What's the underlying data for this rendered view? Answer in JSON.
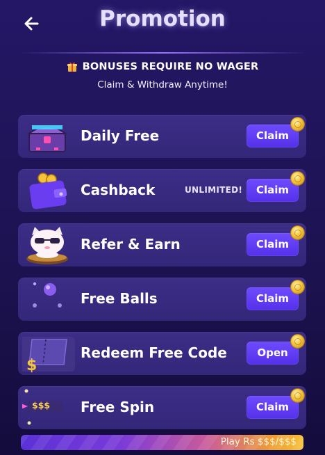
{
  "header": {
    "title": "Promotion",
    "back_icon": "arrow-left-icon"
  },
  "notice": {
    "line1": "BONUSES REQUIRE NO WAGER",
    "line2": "Claim & Withdraw Anytime!",
    "icon": "gift-icon"
  },
  "promotions": [
    {
      "name": "Daily Free",
      "button": "Claim",
      "icon": "treasure-chest-icon"
    },
    {
      "name": "Cashback",
      "badge": "UNLIMITED!",
      "button": "Claim",
      "icon": "wallet-coins-icon"
    },
    {
      "name": "Refer & Earn",
      "button": "Claim",
      "icon": "lucky-cat-icon"
    },
    {
      "name": "Free Balls",
      "button": "Claim",
      "icon": "balls-icon"
    },
    {
      "name": "Redeem Free Code",
      "button": "Open",
      "icon": "ticket-icon"
    },
    {
      "name": "Free Spin",
      "button": "Claim",
      "icon": "spin-icon",
      "tag": "$$$",
      "progress_text": "Play Rs $$$/$$$"
    }
  ],
  "colors": {
    "background": "#1d1352",
    "card": "#372a80",
    "button": "#6340f8",
    "coin": "#f3c43c",
    "title_glow": "#bfaaff"
  }
}
